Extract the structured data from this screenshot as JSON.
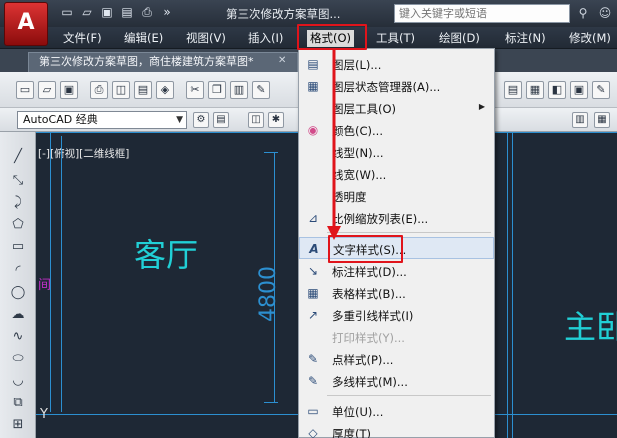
{
  "title_bar": {
    "logo_letter": "A",
    "document_title": "第三次修改方案草图...",
    "search_placeholder": "键入关键字或短语"
  },
  "menus": [
    {
      "id": "file",
      "label": "文件(F)"
    },
    {
      "id": "edit",
      "label": "编辑(E)"
    },
    {
      "id": "view",
      "label": "视图(V)"
    },
    {
      "id": "insert",
      "label": "插入(I)"
    },
    {
      "id": "format",
      "label": "格式(O)"
    },
    {
      "id": "tools",
      "label": "工具(T)"
    },
    {
      "id": "draw",
      "label": "绘图(D)"
    },
    {
      "id": "dimension",
      "label": "标注(N)"
    },
    {
      "id": "modify",
      "label": "修改(M)"
    }
  ],
  "tab": {
    "label": "第三次修改方案草图，商住楼建筑方案草图*",
    "close_glyph": "✕"
  },
  "workspace": {
    "value": "AutoCAD 经典"
  },
  "canvas": {
    "view_label": "[-][俯视][二维线框]",
    "room_living": "客厅",
    "room_master": "主卧",
    "dimension": "4800",
    "left_fragment": "间",
    "y_axis": "Y"
  },
  "format_menu": {
    "items": [
      {
        "label": "图层(L)...",
        "icon": "layers-icon",
        "glyph": "▤",
        "disabled": false,
        "submenu": false
      },
      {
        "label": "图层状态管理器(A)...",
        "icon": "layer-state-icon",
        "glyph": "▦",
        "disabled": false,
        "submenu": false
      },
      {
        "label": "图层工具(O)",
        "icon": "layer-tools-icon",
        "glyph": "",
        "disabled": false,
        "submenu": true
      },
      {
        "label": "颜色(C)...",
        "icon": "color-wheel-icon",
        "glyph": "◉",
        "disabled": false,
        "submenu": false
      },
      {
        "label": "线型(N)...",
        "icon": "linetype-icon",
        "glyph": "",
        "disabled": false,
        "submenu": false
      },
      {
        "label": "线宽(W)...",
        "icon": "lineweight-icon",
        "glyph": "",
        "disabled": false,
        "submenu": false
      },
      {
        "label": "透明度",
        "icon": "transparency-icon",
        "glyph": "",
        "disabled": false,
        "submenu": false
      },
      {
        "label": "比例缩放列表(E)...",
        "icon": "scale-list-icon",
        "glyph": "⊿",
        "disabled": false,
        "submenu": false
      },
      {
        "label": "文字样式(S)...",
        "icon": "text-style-icon",
        "glyph": "A",
        "disabled": false,
        "submenu": false
      },
      {
        "label": "标注样式(D)...",
        "icon": "dimension-style-icon",
        "glyph": "↘",
        "disabled": false,
        "submenu": false
      },
      {
        "label": "表格样式(B)...",
        "icon": "table-style-icon",
        "glyph": "▦",
        "disabled": false,
        "submenu": false
      },
      {
        "label": "多重引线样式(I)",
        "icon": "multileader-style-icon",
        "glyph": "↗",
        "disabled": false,
        "submenu": false
      },
      {
        "label": "打印样式(Y)...",
        "icon": "plot-style-icon",
        "glyph": "",
        "disabled": true,
        "submenu": false
      },
      {
        "label": "点样式(P)...",
        "icon": "point-style-icon",
        "glyph": "✎",
        "disabled": false,
        "submenu": false
      },
      {
        "label": "多线样式(M)...",
        "icon": "multiline-style-icon",
        "glyph": "✎",
        "disabled": false,
        "submenu": false
      },
      {
        "label": "单位(U)...",
        "icon": "units-icon",
        "glyph": "▭",
        "disabled": false,
        "submenu": false
      },
      {
        "label": "厚度(T)",
        "icon": "thickness-icon",
        "glyph": "◇",
        "disabled": false,
        "submenu": false
      }
    ]
  },
  "colors": {
    "highlight_red": "#e0141b",
    "cad_cyan": "#21d0d6",
    "cad_blue": "#2c8fd0",
    "canvas_bg": "#1e2835"
  }
}
